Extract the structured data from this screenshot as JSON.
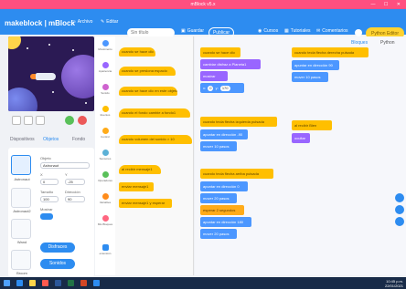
{
  "window": {
    "title": "mBlock v5.x",
    "controls": "— ☐ ✕"
  },
  "menubar": {
    "logo": "makeblock | mBlock",
    "items": [
      {
        "label": "Archivo",
        "icon": "file-icon"
      },
      {
        "label": "Editar",
        "icon": "edit-icon"
      }
    ],
    "project_name": "Sin título",
    "share_label": "Publicar",
    "save_label": "Guardar",
    "right_items": [
      {
        "label": "Cursos",
        "icon": "cursos-icon"
      },
      {
        "label": "Tutoriales",
        "icon": "tutorial-icon"
      },
      {
        "label": "Comentarios",
        "icon": "comment-icon"
      }
    ],
    "python_label": "Python Editor"
  },
  "left_tabs": [
    "Dispositivos",
    "Objetos",
    "Fondo"
  ],
  "sprite_panel": {
    "sprites": [
      {
        "label": "Astronaut"
      },
      {
        "label": "Astronaut2"
      },
      {
        "label": "Wand"
      },
      {
        "label": "Broom"
      }
    ],
    "props": {
      "name_label": "Objeto",
      "name_value": "Astronaut",
      "x_label": "X",
      "x_value": "0",
      "y_label": "Y",
      "y_value": "-25",
      "size_label": "Tamaño",
      "size_value": "100",
      "dir_label": "Dirección",
      "dir_value": "90",
      "show_label": "Mostrar"
    },
    "costume_btn": "Disfraces",
    "sound_btn": "Sonidos"
  },
  "categories": [
    {
      "label": "Movimiento",
      "color": "#4c97ff"
    },
    {
      "label": "Apariencia",
      "color": "#9966ff"
    },
    {
      "label": "Sonido",
      "color": "#cf63cf"
    },
    {
      "label": "Eventos",
      "color": "#ffbf00"
    },
    {
      "label": "Control",
      "color": "#ffab19"
    },
    {
      "label": "Sensores",
      "color": "#5cb1d6"
    },
    {
      "label": "Operadores",
      "color": "#59c059"
    },
    {
      "label": "Variables",
      "color": "#ff8c1a"
    },
    {
      "label": "Mis Bloques",
      "color": "#ff6680"
    },
    {
      "label": "extensión",
      "color": "#2d8cf0"
    }
  ],
  "palette": [
    {
      "text": "cuando se hace clic",
      "color": "#ffbf00",
      "hat": true
    },
    {
      "text": "cuando se presiona espacio",
      "color": "#ffbf00",
      "hat": true
    },
    {
      "text": "cuando se hace clic en este objeto",
      "color": "#ffbf00",
      "hat": true
    },
    {
      "text": "cuando el fondo cambie a fondo1",
      "color": "#ffbf00",
      "hat": true
    },
    {
      "text": "cuando volumen del sonido > 10",
      "color": "#ffbf00",
      "hat": true
    },
    {
      "text": "al recibir mensaje1",
      "color": "#ffbf00",
      "hat": true
    },
    {
      "text": "enviar mensaje1",
      "color": "#ffbf00",
      "hat": false
    },
    {
      "text": "enviar mensaje1 y esperar",
      "color": "#ffbf00",
      "hat": false
    }
  ],
  "scripts": {
    "s1": {
      "hat": "cuando se hace clic",
      "b1": "cambiar disfraz a Planeta1",
      "b2": "mostrar",
      "b3_x": "0",
      "b3_y": "170"
    },
    "s2": {
      "hat": "cuando tecla flecha derecha pulsada",
      "b1": "apuntar en dirección 90",
      "b2": "mover 10 pasos"
    },
    "s3": {
      "hat": "cuando tecla flecha izquierda pulsada",
      "b1": "apuntar en dirección -90",
      "b2": "mover 10 pasos"
    },
    "s4": {
      "hat": "al recibir Bien",
      "b1": "ocultar"
    },
    "s5": {
      "hat": "cuando tecla flecha arriba pulsada",
      "b1": "apuntar en dirección 0",
      "b2": "mover 20 pasos",
      "b3": "esperar 2 segundos",
      "b4": "apuntar en dirección 180",
      "b5": "mover 20 pasos"
    }
  },
  "right_tabs": [
    "Bloques",
    "Python"
  ],
  "tray": {
    "time": "10:45 p.m.",
    "date": "22/01/2021"
  }
}
